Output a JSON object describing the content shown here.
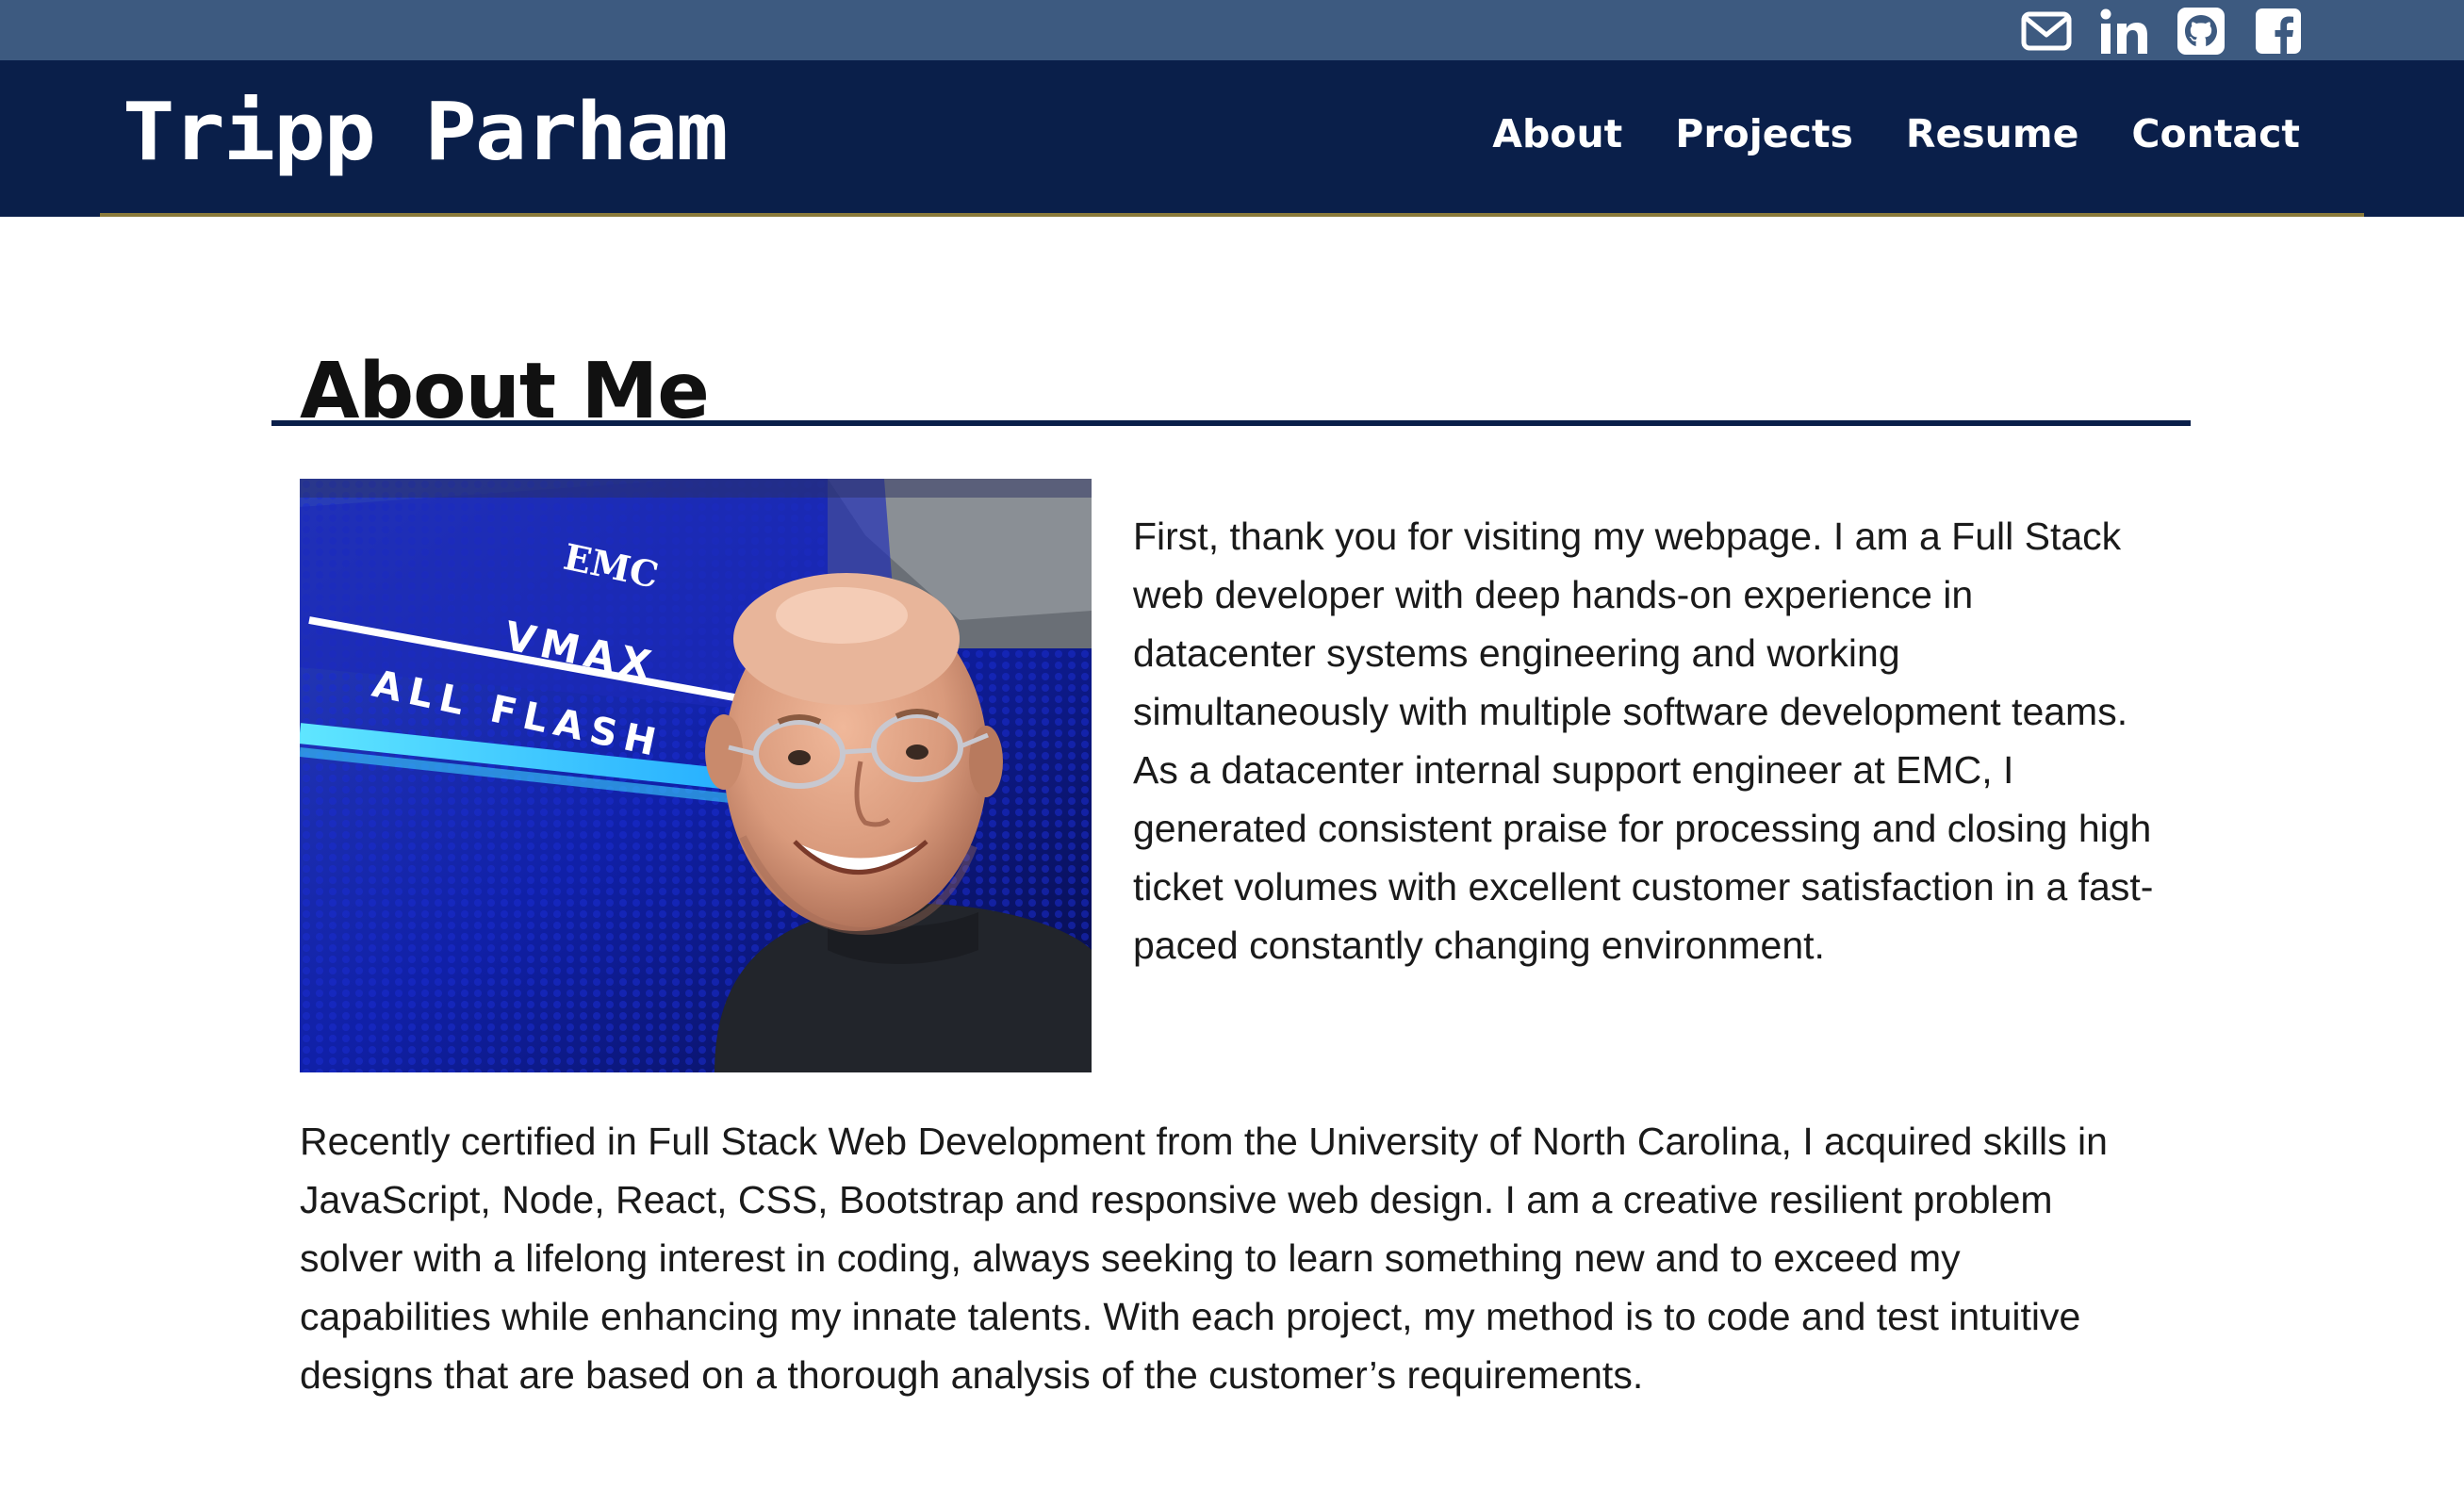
{
  "colors": {
    "topbar": "#3d5a80",
    "navbar": "#0a1f4a",
    "accent_rule": "#8a7a3a",
    "text": "#1a1a1a"
  },
  "social": [
    {
      "icon": "envelope-icon"
    },
    {
      "icon": "linkedin-icon"
    },
    {
      "icon": "github-icon"
    },
    {
      "icon": "facebook-icon"
    }
  ],
  "brand": "Tripp Parham",
  "nav": {
    "about": "About",
    "projects": "Projects",
    "resume": "Resume",
    "contact": "Contact"
  },
  "page": {
    "heading": "About Me",
    "paragraph1": "First, thank you for visiting my webpage. I am a Full Stack web developer with deep hands-on experience in datacenter systems engineering and working simultaneously with multiple software development teams. As a datacenter internal support engineer at EMC, I generated consistent praise for processing and closing high ticket volumes with excellent customer satisfaction in a fast-paced constantly changing environment.",
    "paragraph2": "Recently certified in Full Stack Web Development from the University of North Carolina, I acquired skills in JavaScript, Node, React, CSS, Bootstrap and responsive web design. I am a creative resilient problem solver with a lifelong interest in coding, always seeking to learn something new and to exceed my capabilities while enhancing my innate talents. With each project, my method is to code and test intuitive designs that are based on a thorough analysis of the customer’s requirements."
  },
  "photo_text": {
    "brand": "EMC",
    "model": "VMAX",
    "line": "ALL FLASH"
  }
}
